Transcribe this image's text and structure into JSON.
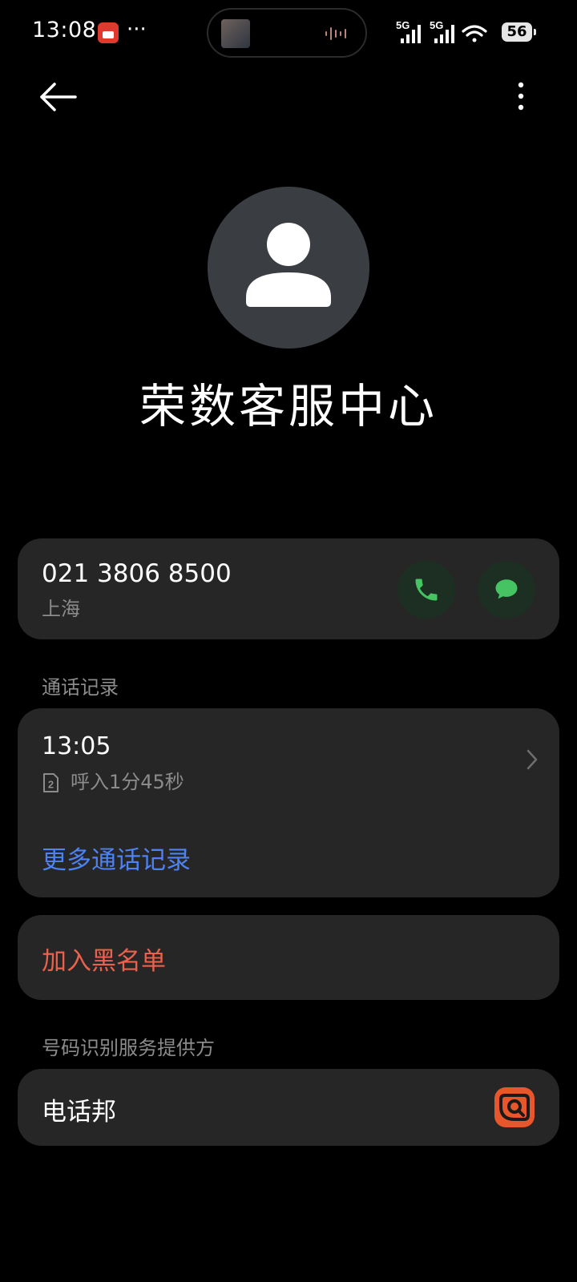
{
  "status_bar": {
    "time": "13:08",
    "dots": "···",
    "network_1": "5G",
    "network_2": "5G",
    "battery": "56"
  },
  "contact": {
    "name": "荣数客服中心"
  },
  "phone": {
    "number": "021 3806 8500",
    "location": "上海"
  },
  "call_history": {
    "section_label": "通话记录",
    "entries": [
      {
        "time": "13:05",
        "sim": "2",
        "detail": "呼入1分45秒"
      }
    ],
    "more_label": "更多通话记录"
  },
  "block": {
    "label": "加入黑名单"
  },
  "provider": {
    "section_label": "号码识别服务提供方",
    "name": "电话邦"
  },
  "colors": {
    "background": "#000000",
    "card": "#262626",
    "link_blue": "#4d82f0",
    "danger_red": "#e8624e",
    "call_green": "#46c463",
    "provider_orange": "#e8572b"
  },
  "icons": {
    "back": "arrow-left-icon",
    "more": "more-vertical-icon",
    "avatar": "person-icon",
    "call": "phone-icon",
    "message": "message-icon",
    "sim": "sim-2-icon",
    "chevron": "chevron-right-icon",
    "provider_logo": "dianhuabang-logo-icon"
  }
}
